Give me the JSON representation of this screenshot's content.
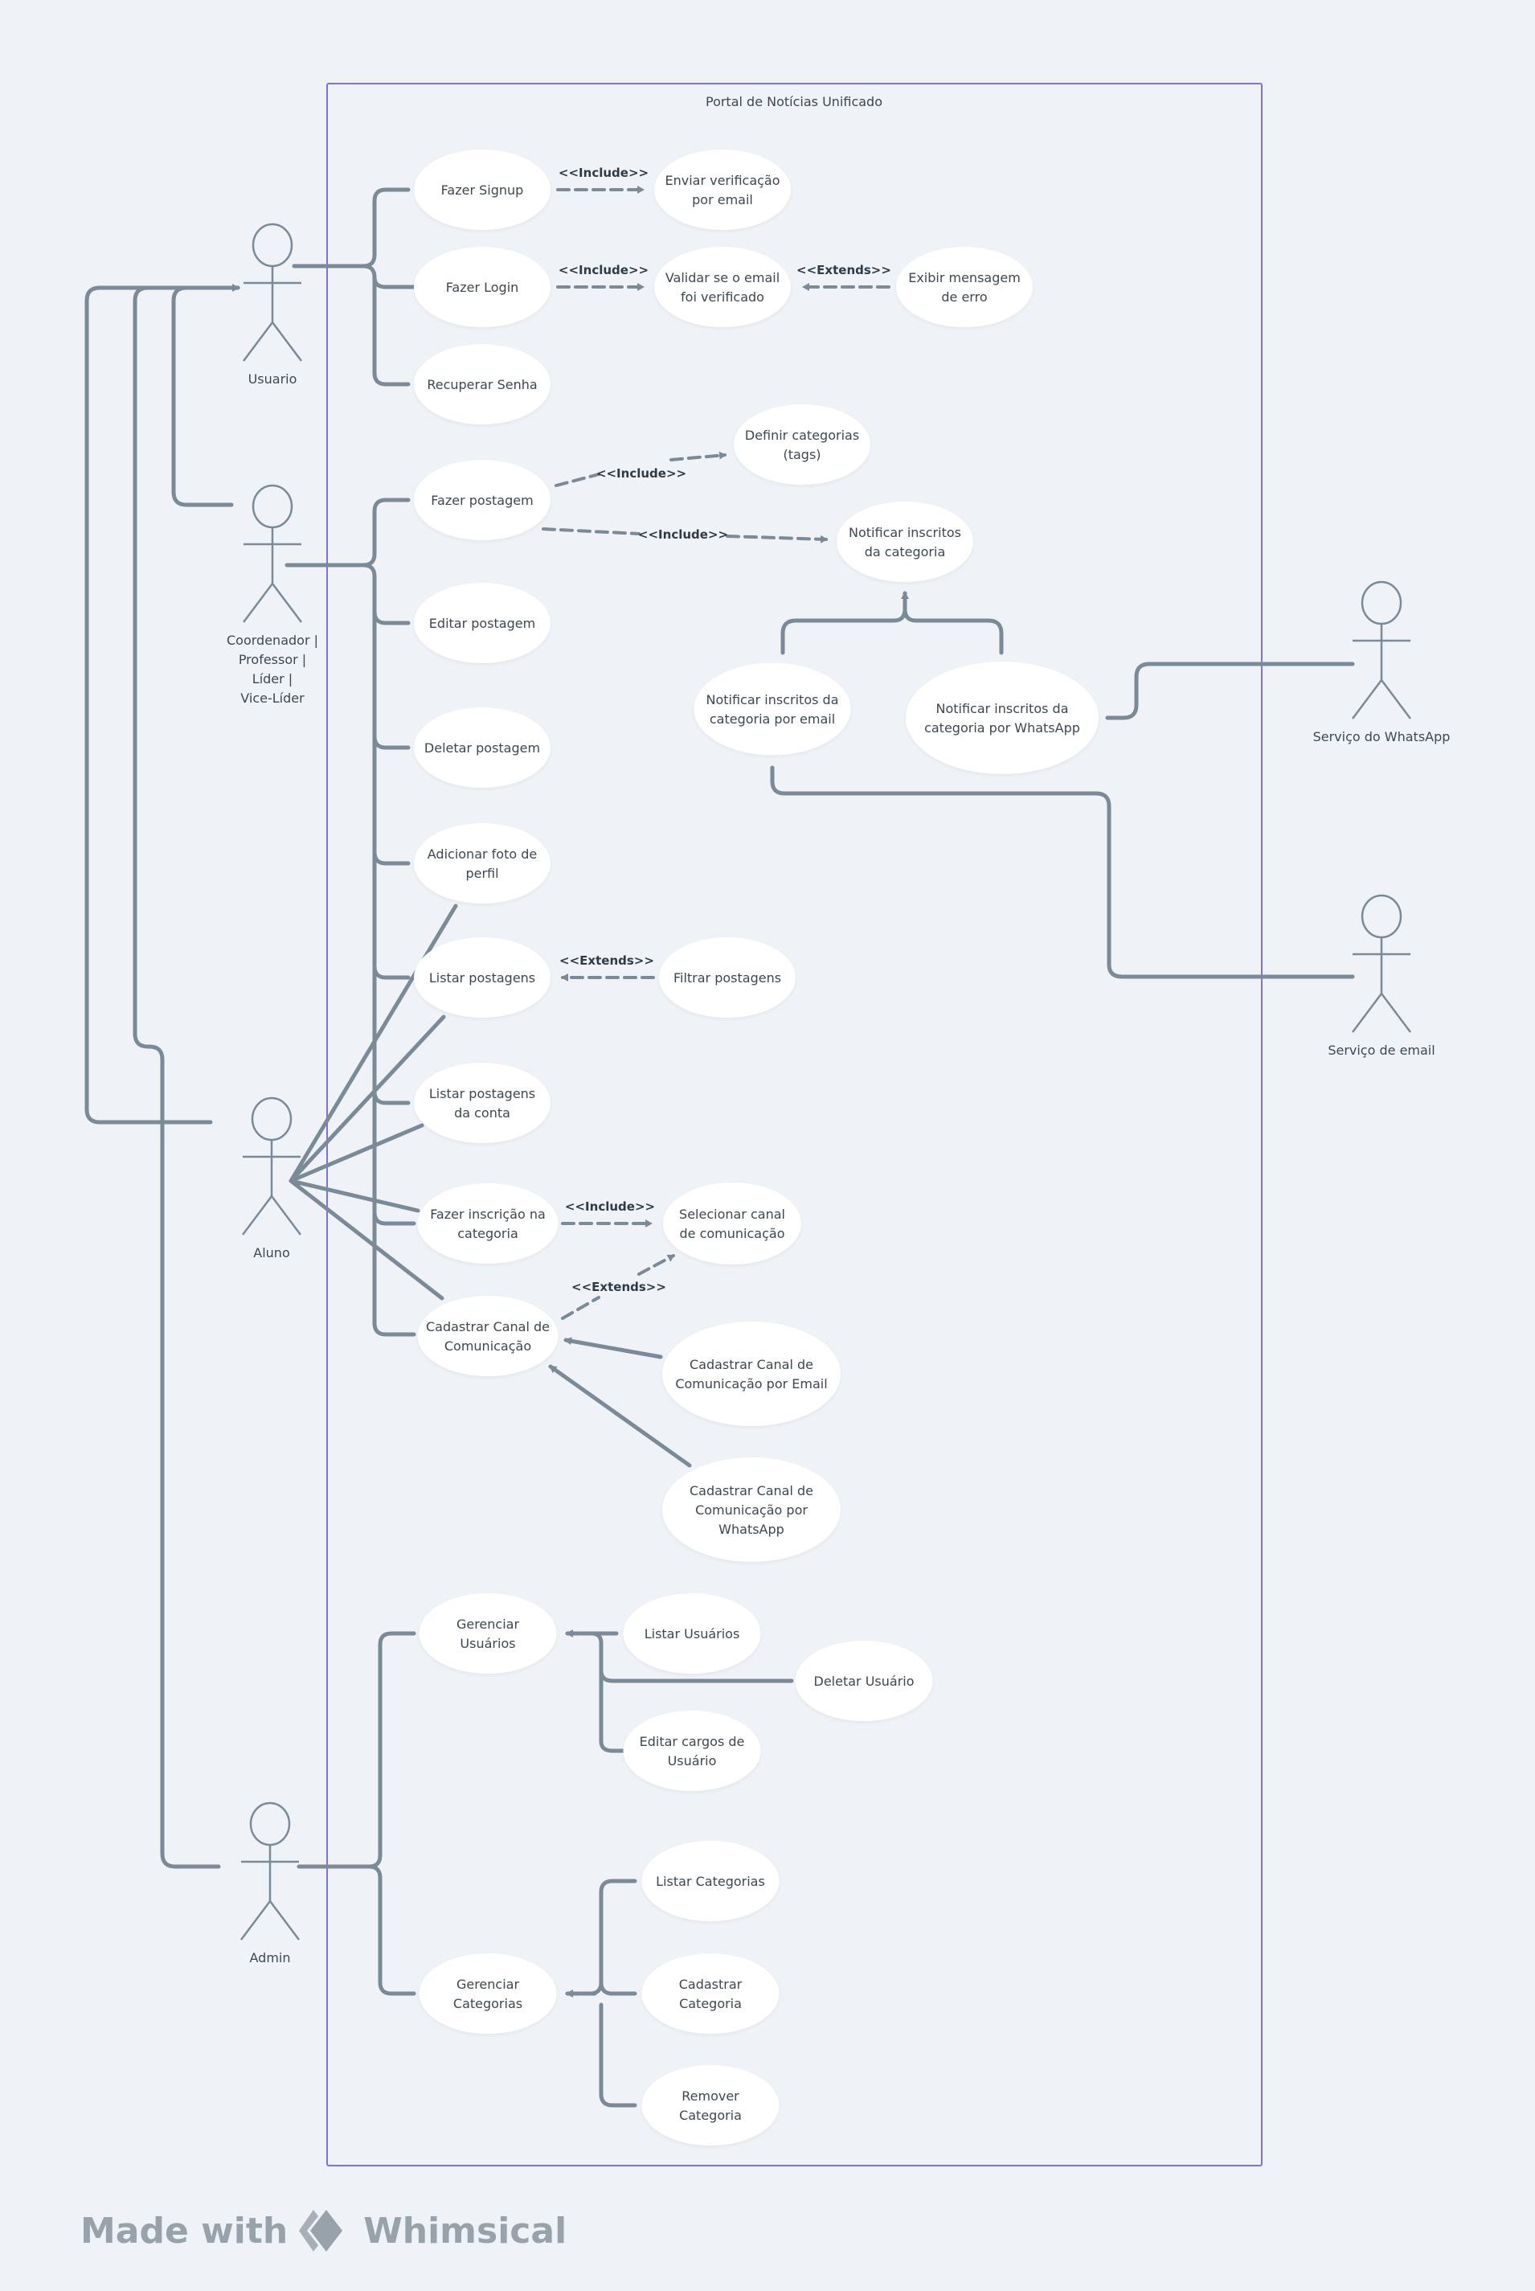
{
  "system": {
    "title": "Portal de Notícias Unificado",
    "border_color": "#7b6ff0"
  },
  "colors": {
    "background": "#eff3f7",
    "line": "#7b8a97",
    "usecase_fill": "#ffffff",
    "text": "#3d4752"
  },
  "actors": [
    {
      "id": "usuario",
      "label": [
        "Usuario"
      ]
    },
    {
      "id": "coordenador",
      "label": [
        "Coordenador |",
        "Professor |",
        "Líder |",
        "Vice-Líder"
      ]
    },
    {
      "id": "aluno",
      "label": [
        "Aluno"
      ]
    },
    {
      "id": "admin",
      "label": [
        "Admin"
      ]
    },
    {
      "id": "whatsapp",
      "label": [
        "Serviço do WhatsApp"
      ]
    },
    {
      "id": "email",
      "label": [
        "Serviço de email"
      ]
    }
  ],
  "use_cases": [
    {
      "id": "signup",
      "label": [
        "Fazer Signup"
      ]
    },
    {
      "id": "enviar_verif",
      "label": [
        "Enviar verificação",
        "por email"
      ]
    },
    {
      "id": "login",
      "label": [
        "Fazer Login"
      ]
    },
    {
      "id": "validar",
      "label": [
        "Validar se o email",
        "foi verificado"
      ]
    },
    {
      "id": "erro",
      "label": [
        "Exibir mensagem",
        "de erro"
      ]
    },
    {
      "id": "recuperar",
      "label": [
        "Recuperar Senha"
      ]
    },
    {
      "id": "definir_cat",
      "label": [
        "Definir categorias",
        "(tags)"
      ]
    },
    {
      "id": "postagem",
      "label": [
        "Fazer postagem"
      ]
    },
    {
      "id": "notificar",
      "label": [
        "Notificar inscritos",
        "da categoria"
      ]
    },
    {
      "id": "editar_post",
      "label": [
        "Editar postagem"
      ]
    },
    {
      "id": "notif_email",
      "label": [
        "Notificar inscritos da",
        "categoria por email"
      ]
    },
    {
      "id": "notif_whats",
      "label": [
        "Notificar inscritos da",
        "categoria por WhatsApp"
      ]
    },
    {
      "id": "deletar_post",
      "label": [
        "Deletar postagem"
      ]
    },
    {
      "id": "foto",
      "label": [
        "Adicionar foto de",
        "perfil"
      ]
    },
    {
      "id": "listar_post",
      "label": [
        "Listar postagens"
      ]
    },
    {
      "id": "filtrar",
      "label": [
        "Filtrar postagens"
      ]
    },
    {
      "id": "listar_conta",
      "label": [
        "Listar postagens",
        "da conta"
      ]
    },
    {
      "id": "inscricao",
      "label": [
        "Fazer inscrição na",
        "categoria"
      ]
    },
    {
      "id": "selecionar",
      "label": [
        "Selecionar canal",
        "de comunicação"
      ]
    },
    {
      "id": "cad_canal",
      "label": [
        "Cadastrar Canal de",
        "Comunicação"
      ]
    },
    {
      "id": "cad_email",
      "label": [
        "Cadastrar Canal de",
        "Comunicação por Email"
      ]
    },
    {
      "id": "cad_whats",
      "label": [
        "Cadastrar Canal de",
        "Comunicação por",
        "WhatsApp"
      ]
    },
    {
      "id": "ger_usuarios",
      "label": [
        "Gerenciar",
        "Usuários"
      ]
    },
    {
      "id": "listar_usuarios",
      "label": [
        "Listar Usuários"
      ]
    },
    {
      "id": "deletar_usuario",
      "label": [
        "Deletar Usuário"
      ]
    },
    {
      "id": "editar_cargos",
      "label": [
        "Editar cargos de",
        "Usuário"
      ]
    },
    {
      "id": "listar_cat",
      "label": [
        "Listar Categorias"
      ]
    },
    {
      "id": "ger_cat",
      "label": [
        "Gerenciar",
        "Categorias"
      ]
    },
    {
      "id": "cad_cat",
      "label": [
        "Cadastrar",
        "Categoria"
      ]
    },
    {
      "id": "rem_cat",
      "label": [
        "Remover",
        "Categoria"
      ]
    }
  ],
  "relations": [
    {
      "type": "include",
      "label": "<<Include>>",
      "from": "signup",
      "to": "enviar_verif"
    },
    {
      "type": "include",
      "label": "<<Include>>",
      "from": "login",
      "to": "validar"
    },
    {
      "type": "extends",
      "label": "<<Extends>>",
      "from": "erro",
      "to": "validar"
    },
    {
      "type": "include",
      "label": "<<Include>>",
      "from": "postagem",
      "to": "definir_cat"
    },
    {
      "type": "include",
      "label": "<<Include>>",
      "from": "postagem",
      "to": "notificar"
    },
    {
      "type": "extends",
      "label": "<<Extends>>",
      "from": "filtrar",
      "to": "listar_post"
    },
    {
      "type": "include",
      "label": "<<Include>>",
      "from": "inscricao",
      "to": "selecionar"
    },
    {
      "type": "extends",
      "label": "<<Extends>>",
      "from": "cad_canal",
      "to": "selecionar"
    }
  ],
  "footer": {
    "made_with": "Made with",
    "brand": "Whimsical"
  }
}
